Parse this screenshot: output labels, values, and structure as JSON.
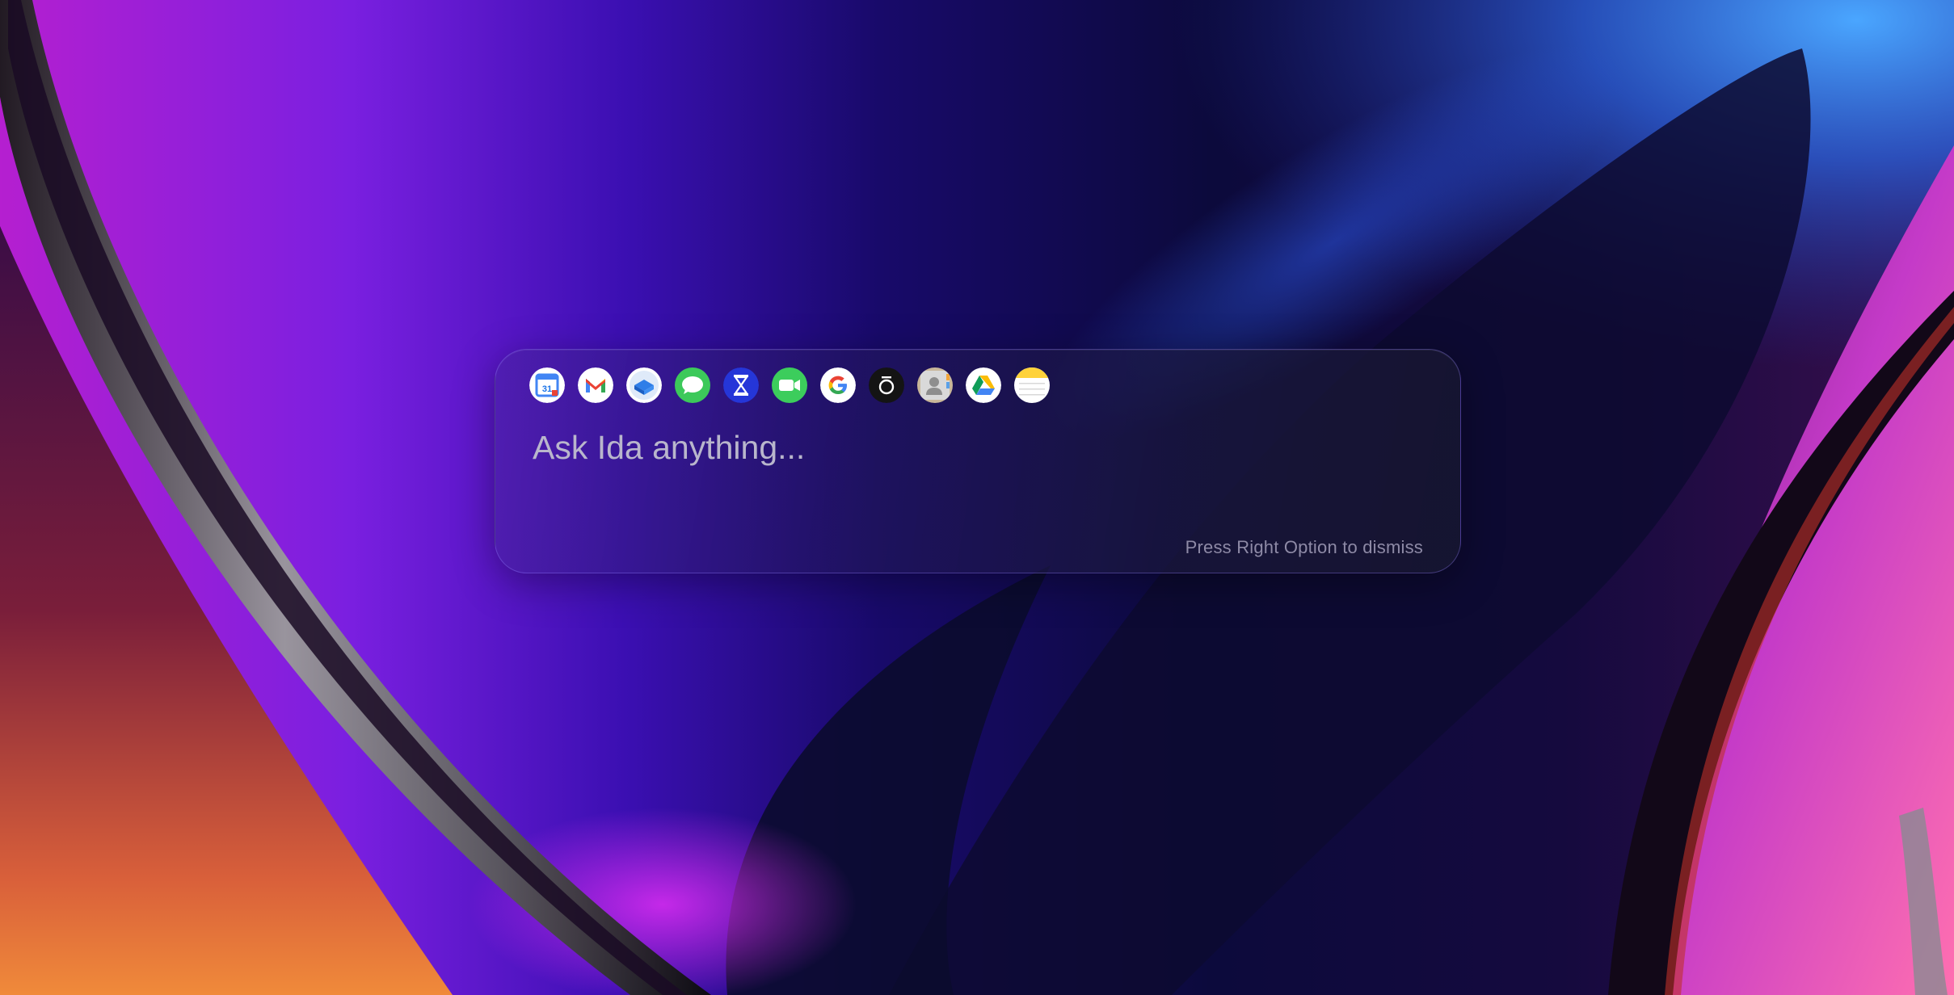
{
  "assistant": {
    "prompt_placeholder": "Ask Ida anything...",
    "dismiss_hint": "Press Right Option to dismiss",
    "integrations": [
      {
        "icon": "google-calendar-icon",
        "text": "31"
      },
      {
        "icon": "gmail-icon"
      },
      {
        "icon": "mail-app-icon"
      },
      {
        "icon": "messages-icon"
      },
      {
        "icon": "hourglass-app-icon"
      },
      {
        "icon": "facetime-icon"
      },
      {
        "icon": "google-icon"
      },
      {
        "icon": "oura-ring-icon"
      },
      {
        "icon": "contacts-icon"
      },
      {
        "icon": "google-drive-icon"
      },
      {
        "icon": "notes-icon"
      }
    ]
  },
  "colors": {
    "panel_border": "#8f7fff",
    "placeholder_text": "#b9b6cc",
    "hint_text": "#8e8aa6"
  }
}
